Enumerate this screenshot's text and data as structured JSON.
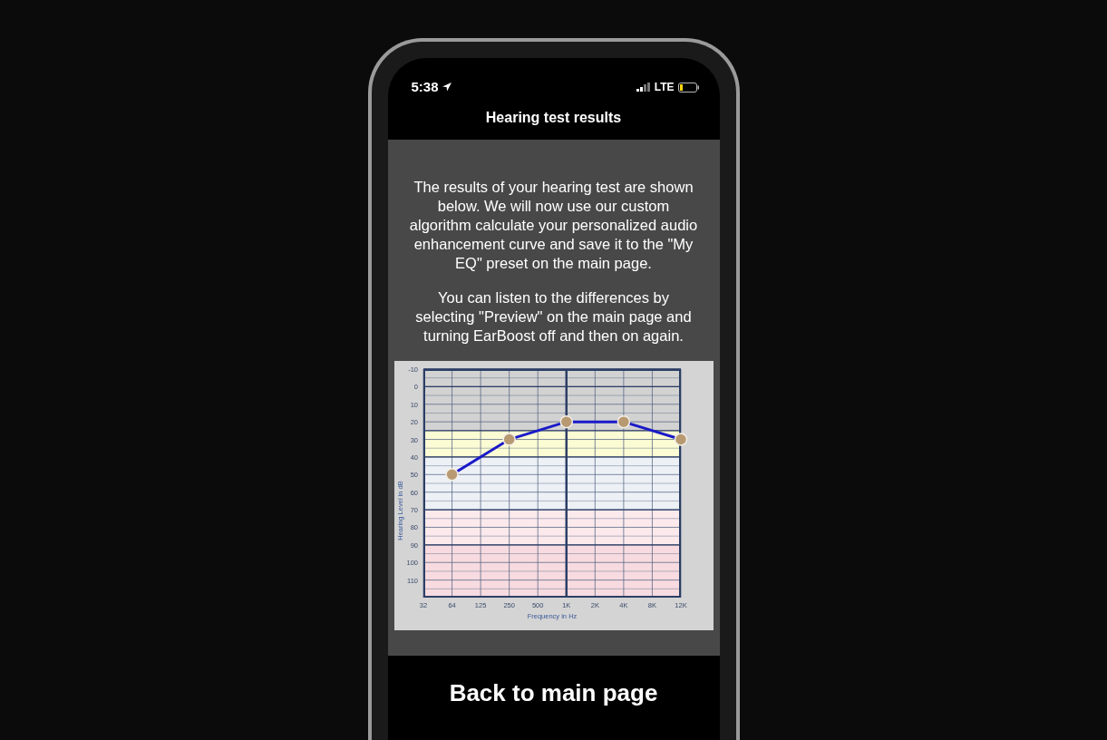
{
  "status_bar": {
    "time": "5:38",
    "network": "LTE"
  },
  "title": "Hearing test results",
  "intro": [
    "The results of your hearing test are shown below. We will now use our custom algorithm calculate your personalized audio enhancement curve and save it to the \"My EQ\" preset on the main page.",
    "You can listen to the differences by selecting \"Preview\" on the main page and turning EarBoost off and then on again."
  ],
  "audiogram": {
    "chart_data": {
      "type": "line",
      "xlabel": "Frequency in Hz",
      "ylabel": "Hearing Level in dB",
      "categories": [
        "32",
        "64",
        "125",
        "250",
        "500",
        "1K",
        "2K",
        "4K",
        "8K",
        "12K"
      ],
      "series": [
        {
          "color": "#1a1ac8",
          "marker": "o",
          "values": [
            null,
            50,
            null,
            30,
            null,
            20,
            null,
            20,
            null,
            30
          ]
        }
      ],
      "grid": true,
      "ref_lines": [
        {
          "axis": "x",
          "value": "1K",
          "color": "#2c3e66"
        }
      ],
      "bands": [
        {
          "axis": "y",
          "from": 25,
          "to": 40,
          "color": "#fbfbd4"
        },
        {
          "axis": "y",
          "from": 40,
          "to": 70,
          "color": "#edf1f6"
        },
        {
          "axis": "y",
          "from": 70,
          "to": 90,
          "color": "#fbe9ec"
        },
        {
          "axis": "y",
          "from": 90,
          "to": 120,
          "color": "#f7dbe0"
        }
      ],
      "ylim": [
        120,
        -10
      ],
      "yticks": [
        -10,
        0,
        10,
        20,
        30,
        40,
        50,
        60,
        70,
        80,
        90,
        100,
        110
      ]
    }
  },
  "back_button": "Back to main page"
}
